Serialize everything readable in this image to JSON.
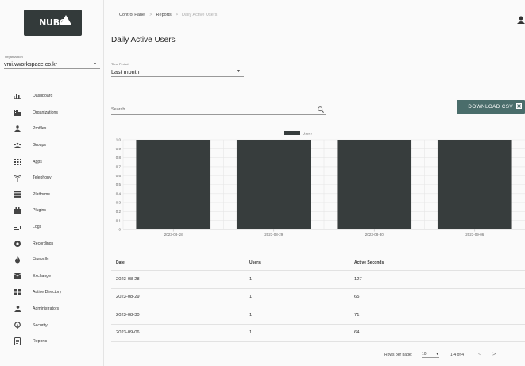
{
  "logo": {
    "text": "NUBO"
  },
  "organization": {
    "label": "Organization",
    "value": "vmi.vworkspace.co.kr"
  },
  "nav": [
    {
      "label": "Dashboard",
      "icon": "bar-chart-icon"
    },
    {
      "label": "Organizations",
      "icon": "building-icon"
    },
    {
      "label": "Profiles",
      "icon": "people-icon"
    },
    {
      "label": "Groups",
      "icon": "group-icon"
    },
    {
      "label": "Apps",
      "icon": "apps-grid-icon"
    },
    {
      "label": "Telephony",
      "icon": "antenna-icon"
    },
    {
      "label": "Platforms",
      "icon": "server-icon"
    },
    {
      "label": "Plugins",
      "icon": "plugin-icon"
    },
    {
      "label": "Logs",
      "icon": "logs-icon"
    },
    {
      "label": "Recordings",
      "icon": "record-icon"
    },
    {
      "label": "Firewalls",
      "icon": "fire-icon"
    },
    {
      "label": "Exchange",
      "icon": "mail-icon"
    },
    {
      "label": "Active Directory",
      "icon": "directory-grid-icon"
    },
    {
      "label": "Administrators",
      "icon": "admin-icon"
    },
    {
      "label": "Security",
      "icon": "security-icon"
    },
    {
      "label": "Reports",
      "icon": "report-icon"
    }
  ],
  "breadcrumb": {
    "items": [
      "Control Panel",
      "Reports"
    ],
    "separator": ">",
    "current": "Daily Active Users"
  },
  "page_title": "Daily Active Users",
  "time_period": {
    "label": "Time Period",
    "value": "Last month"
  },
  "search": {
    "placeholder": "Search"
  },
  "download_button": {
    "label": "DOWNLOAD CSV"
  },
  "chart_data": {
    "type": "bar",
    "categories": [
      "2023-08-28",
      "2023-08-29",
      "2023-08-30",
      "2023-09-06"
    ],
    "series": [
      {
        "name": "Users",
        "values": [
          1,
          1,
          1,
          1
        ]
      }
    ],
    "ylim": [
      0,
      1.0
    ],
    "yticks": [
      "1.0",
      "0.9",
      "0.8",
      "0.7",
      "0.6",
      "0.5",
      "0.4",
      "0.3",
      "0.2",
      "0.1",
      "0"
    ],
    "legend": "top-center",
    "grid": true,
    "bar_color": "#373d3d"
  },
  "table": {
    "headers": [
      "Date",
      "Users",
      "Active Seconds"
    ],
    "rows": [
      [
        "2023-08-28",
        "1",
        "127"
      ],
      [
        "2023-08-29",
        "1",
        "65"
      ],
      [
        "2023-08-30",
        "1",
        "71"
      ],
      [
        "2023-09-06",
        "1",
        "64"
      ]
    ]
  },
  "pagination": {
    "rows_per_page_label": "Rows per page:",
    "rows_per_page": "10",
    "range": "1-4 of 4",
    "prev": "<",
    "next": ">"
  },
  "colors": {
    "accent": "#4a6d6b",
    "logo_bg": "#333a3a",
    "bar": "#373d3d"
  }
}
